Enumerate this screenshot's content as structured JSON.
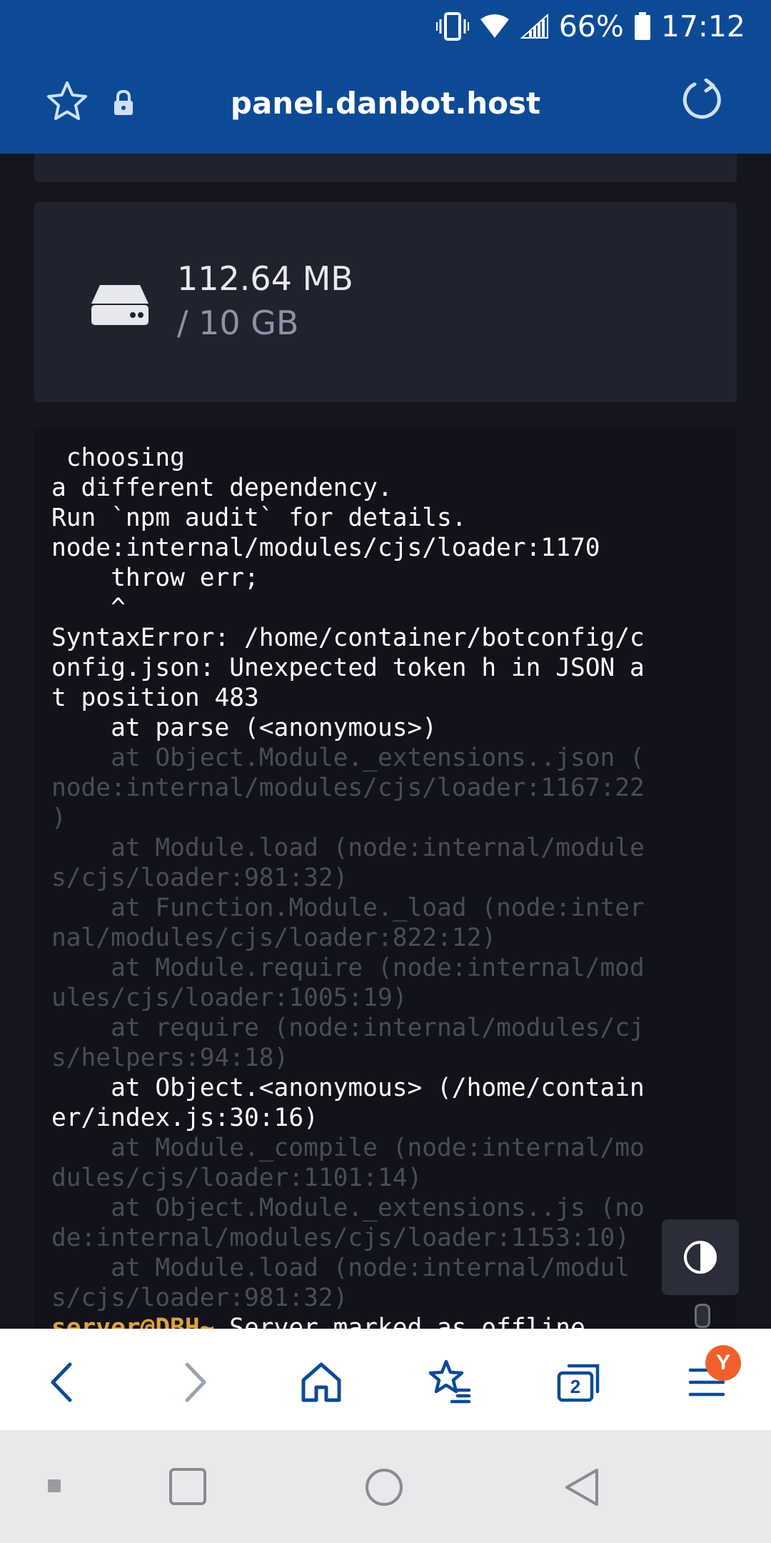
{
  "status_bar": {
    "battery": "66%",
    "time": "17:12"
  },
  "browser": {
    "url_title": "panel.danbot.host",
    "tabs_count": "2",
    "profile_letter": "Y"
  },
  "disk": {
    "used": "112.64 MB",
    "total": "/ 10 GB"
  },
  "console": {
    "lines": [
      {
        "text": " choosing",
        "style": "normal"
      },
      {
        "text": "a different dependency.",
        "style": "normal"
      },
      {
        "text": "Run `npm audit` for details.",
        "style": "normal"
      },
      {
        "text": "node:internal/modules/cjs/loader:1170",
        "style": "normal"
      },
      {
        "text": "    throw err;",
        "style": "normal"
      },
      {
        "text": "    ^",
        "style": "normal"
      },
      {
        "text": "SyntaxError: /home/container/botconfig/c",
        "style": "normal"
      },
      {
        "text": "onfig.json: Unexpected token h in JSON a",
        "style": "normal"
      },
      {
        "text": "t position 483",
        "style": "normal"
      },
      {
        "text": "    at parse (<anonymous>)",
        "style": "normal"
      },
      {
        "text": "    at Object.Module._extensions..json (",
        "style": "dim"
      },
      {
        "text": "node:internal/modules/cjs/loader:1167:22",
        "style": "dim"
      },
      {
        "text": ")",
        "style": "dim"
      },
      {
        "text": "    at Module.load (node:internal/module",
        "style": "dim"
      },
      {
        "text": "s/cjs/loader:981:32)",
        "style": "dim"
      },
      {
        "text": "    at Function.Module._load (node:inter",
        "style": "dim"
      },
      {
        "text": "nal/modules/cjs/loader:822:12)",
        "style": "dim"
      },
      {
        "text": "    at Module.require (node:internal/mod",
        "style": "dim"
      },
      {
        "text": "ules/cjs/loader:1005:19)",
        "style": "dim"
      },
      {
        "text": "    at require (node:internal/modules/cj",
        "style": "dim"
      },
      {
        "text": "s/helpers:94:18)",
        "style": "dim"
      },
      {
        "text": "    at Object.<anonymous> (/home/contain",
        "style": "normal"
      },
      {
        "text": "er/index.js:30:16)",
        "style": "normal"
      },
      {
        "text": "    at Module._compile (node:internal/mo",
        "style": "dim"
      },
      {
        "text": "dules/cjs/loader:1101:14)",
        "style": "dim"
      },
      {
        "text": "    at Object.Module._extensions..js (no",
        "style": "dim"
      },
      {
        "text": "de:internal/modules/cjs/loader:1153:10)",
        "style": "dim"
      },
      {
        "text": "    at Module.load (node:internal/modul",
        "style": "dim"
      },
      {
        "text": "s/cjs/loader:981:32)",
        "style": "dim"
      }
    ],
    "last_line": {
      "prompt": "server@DBH~",
      "message": " Server marked as offline..."
    }
  },
  "icons": {
    "bookmark": "star-icon",
    "secure": "lock-icon",
    "reload": "reload-icon",
    "disk": "hard-drive-icon",
    "contrast": "contrast-icon",
    "back": "chevron-left-icon",
    "forward": "chevron-right-icon",
    "home": "home-icon",
    "bookmarks": "star-list-icon",
    "tabs": "tabs-icon",
    "menu": "menu-icon"
  },
  "colors": {
    "top_bar": "#0d4a96",
    "panel_card": "#20222d",
    "prompt": "#e0a23a",
    "badge": "#f0602c"
  }
}
